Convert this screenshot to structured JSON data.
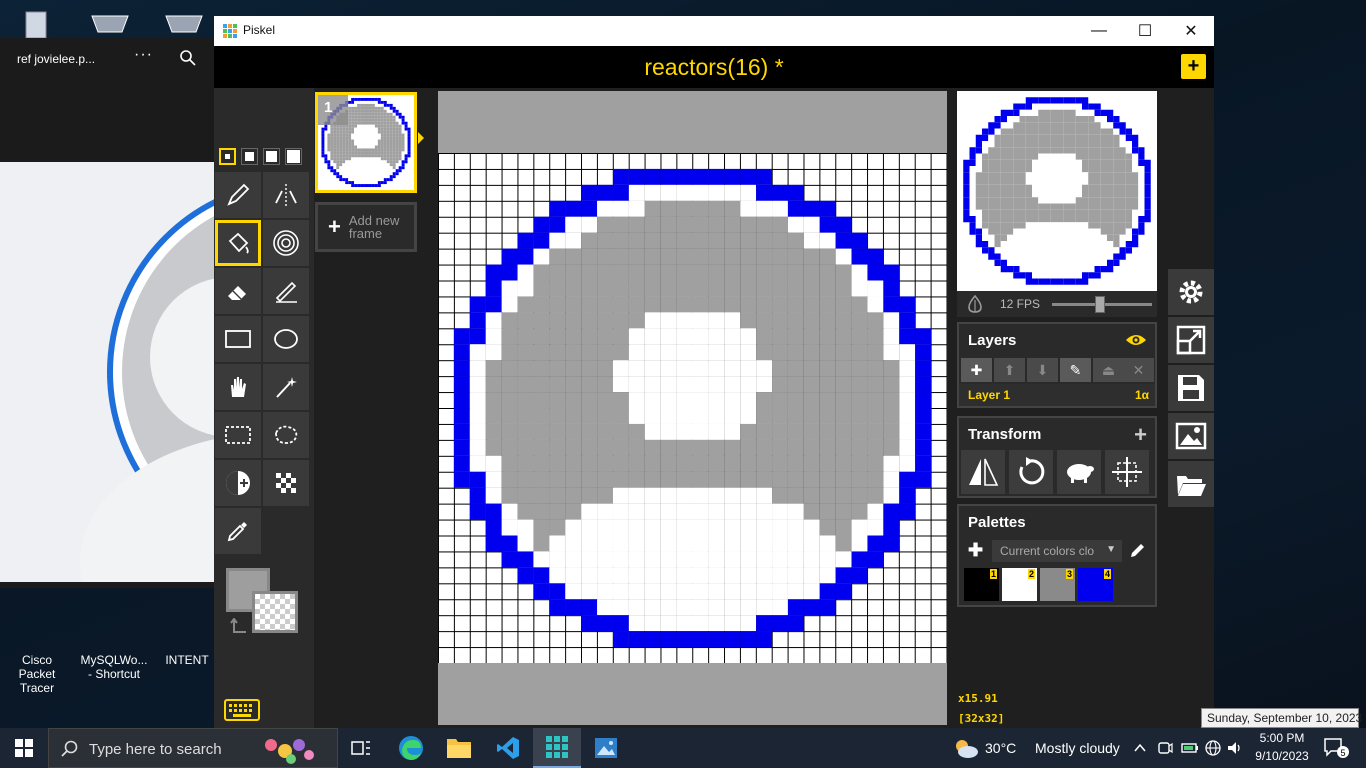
{
  "desktop": {
    "labels": [
      {
        "text": "Cisco Packet\nTracer"
      },
      {
        "text": "MySQLWo...\n- Shortcut"
      },
      {
        "text": "INTENT"
      }
    ]
  },
  "viewer": {
    "title": "ref jovielee.p...",
    "more": "···"
  },
  "window": {
    "app_title": "Piskel",
    "minimize": "—",
    "maximize": "☐",
    "close": "✕"
  },
  "header": {
    "document_title": "reactors(16) *",
    "new_button": "+"
  },
  "frames": {
    "frame1_number": "1",
    "add_frame_label": "Add new\nframe"
  },
  "canvas": {
    "zoom": "x15.91",
    "size": "[32x32]",
    "grid_cols": 32,
    "grid_rows": 32
  },
  "preview": {
    "fps_label": "12 FPS",
    "fps_value": 12
  },
  "layers": {
    "title": "Layers",
    "layer_name": "Layer 1",
    "layer_alpha": "1α"
  },
  "transform": {
    "title": "Transform"
  },
  "palettes": {
    "title": "Palettes",
    "selected": "Current colors clo",
    "swatches": [
      {
        "num": "1",
        "color": "#000000"
      },
      {
        "num": "2",
        "color": "#ffffff"
      },
      {
        "num": "3",
        "color": "#8a8a8a"
      },
      {
        "num": "4",
        "color": "#0000ee"
      }
    ]
  },
  "colors": {
    "accent": "#ffd700",
    "primary": "#9e9e9e",
    "ring": "#0000ee",
    "silhouette_bg": "#a0a0a0"
  },
  "taskbar": {
    "search_placeholder": "Type here to search",
    "weather_temp": "30°C",
    "weather_desc": "Mostly cloudy",
    "time": "5:00 PM",
    "date": "9/10/2023",
    "tooltip": "Sunday, September 10, 2023",
    "notification_count": "5"
  }
}
